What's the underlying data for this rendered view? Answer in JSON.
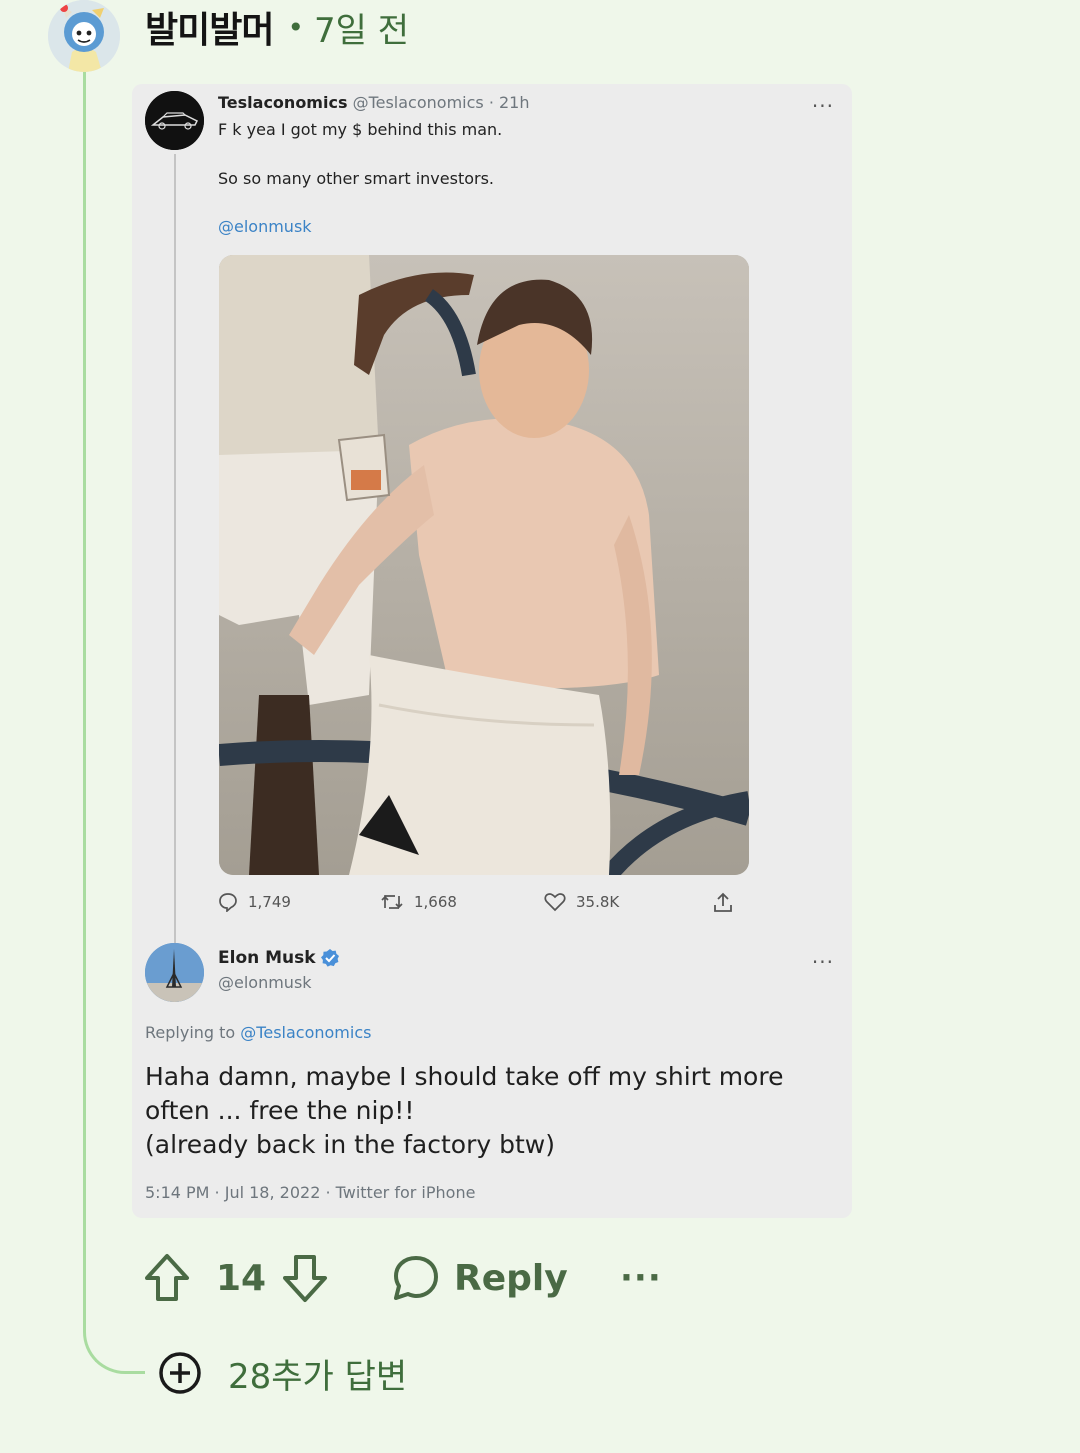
{
  "comment": {
    "username": "발미발머",
    "separator": "•",
    "timestamp": "7일 전",
    "avatar": "cartoon-avatar"
  },
  "tweet_screenshot": {
    "original_tweet": {
      "name": "Teslaconomics",
      "handle_time": "@Teslaconomics · 21h",
      "more": "···",
      "line1": "F    k yea I got my $ behind this man.",
      "line2": "So so many other smart investors.",
      "mention": "@elonmusk",
      "photo": "shirtless-man-on-boat-photo",
      "stats": {
        "replies": "1,749",
        "retweets": "1,668",
        "likes": "35.8K"
      }
    },
    "reply_tweet": {
      "name": "Elon Musk",
      "verified": "verified-badge",
      "handle": "@elonmusk",
      "more": "···",
      "replying_prefix": "Replying to",
      "replying_to": "@Teslaconomics",
      "body_line1": "Haha damn, maybe I should take off my shirt more",
      "body_line2": "often ... free the nip!!",
      "body_line3": "(already back in the factory btw)",
      "meta": "5:14 PM · Jul 18, 2022 · Twitter for iPhone"
    }
  },
  "actions": {
    "vote_count": "14",
    "reply_label": "Reply",
    "more": "···"
  },
  "more_replies": {
    "label": "28추가 답변"
  },
  "colors": {
    "background": "#eff7ea",
    "accent_green": "#3f6e3c",
    "thread_line": "#a9dca0",
    "tweet_link": "#3b83c6"
  }
}
